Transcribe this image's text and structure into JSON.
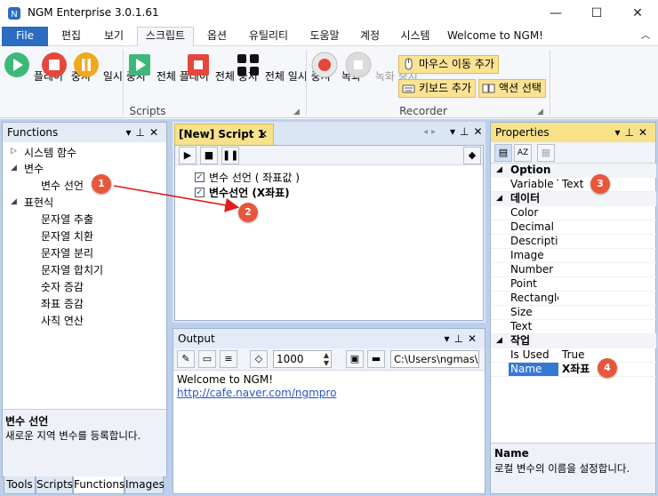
{
  "window": {
    "title": "NGM Enterprise 3.0.1.61"
  },
  "menu": {
    "file": "File",
    "items": [
      "편집",
      "보기",
      "스크립트",
      "옵션",
      "유틸리티",
      "도움말",
      "계정",
      "시스템",
      "Welcome to NGM!"
    ]
  },
  "ribbon": {
    "script_group": {
      "label": "Scripts",
      "buttons": [
        "플레이",
        "중지",
        "일시 중지",
        "전체 플레이",
        "전체 중지",
        "전체 일시 중지"
      ]
    },
    "recorder_group": {
      "label": "Recorder",
      "buttons": [
        "녹화",
        "녹화 중지"
      ],
      "small_buttons": [
        "마우스 이동 추가",
        "키보드 추가",
        "액션 선택"
      ]
    }
  },
  "functions_panel": {
    "title": "Functions",
    "tree": [
      "시스템 함수",
      "변수",
      "변수 선언",
      "표현식",
      "문자열 추출",
      "문자열 치환",
      "문자열 분리",
      "문자열 합치기",
      "숫자 증감",
      "좌표 증감",
      "사칙 연산"
    ],
    "description_title": "변수 선언",
    "description_text": "새로운 지역 변수를 등록합니다.",
    "tabs": [
      "Tools",
      "Scripts",
      "Functions",
      "Images"
    ]
  },
  "script_panel": {
    "tab_label": "[New] Script 1",
    "lines": [
      {
        "checked": true,
        "text": "변수 선언 ( 좌표값 )",
        "bold": false
      },
      {
        "checked": true,
        "text": "변수선언 (X좌표)",
        "bold": true
      }
    ]
  },
  "output_panel": {
    "title": "Output",
    "zoom_value": "1000",
    "path_value": "C:\\Users\\ngmas\\D",
    "lines": [
      "Welcome to NGM!",
      "http://cafe.naver.com/ngmpro"
    ]
  },
  "properties_panel": {
    "title": "Properties",
    "categories": [
      {
        "name": "Option",
        "rows": [
          {
            "name": "Variable T",
            "value": "Text"
          }
        ]
      },
      {
        "name": "데이터",
        "rows": [
          {
            "name": "Color",
            "value": ""
          },
          {
            "name": "Decimal",
            "value": ""
          },
          {
            "name": "Description",
            "value": ""
          },
          {
            "name": "Image",
            "value": ""
          },
          {
            "name": "Number",
            "value": ""
          },
          {
            "name": "Point",
            "value": ""
          },
          {
            "name": "Rectangle",
            "value": ""
          },
          {
            "name": "Size",
            "value": ""
          },
          {
            "name": "Text",
            "value": ""
          }
        ]
      },
      {
        "name": "작업",
        "rows": [
          {
            "name": "Is Used",
            "value": "True"
          },
          {
            "name": "Name",
            "value": "X좌표"
          }
        ]
      }
    ],
    "description_title": "Name",
    "description_text": "로컬 변수의 이름을 설정합니다."
  },
  "annotations": [
    "1",
    "2",
    "3",
    "4"
  ],
  "colors": {
    "accent_blue": "#2b6bc2",
    "tab_yellow": "#f7e28a",
    "badge_red": "#e8573a",
    "selection_blue": "#3478d4"
  }
}
